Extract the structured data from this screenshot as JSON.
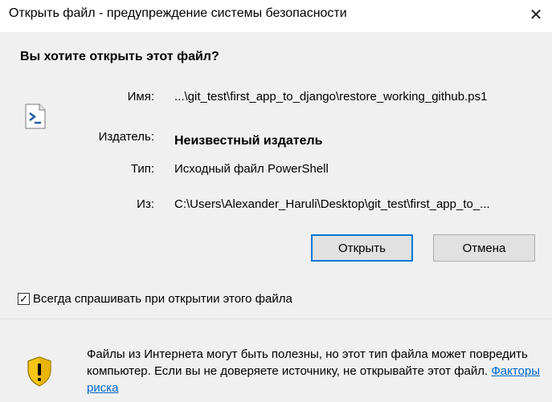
{
  "window": {
    "title": "Открыть файл - предупреждение системы безопасности",
    "close_glyph": "✕"
  },
  "question": "Вы хотите открыть этот файл?",
  "file_icon": "powershell-script-icon",
  "fields": {
    "name_label": "Имя:",
    "name_value": "...\\git_test\\first_app_to_django\\restore_working_github.ps1",
    "publisher_label": "Издатель:",
    "publisher_value": "Неизвестный издатель",
    "type_label": "Тип:",
    "type_value": "Исходный файл PowerShell",
    "from_label": "Из:",
    "from_value": "C:\\Users\\Alexander_Haruli\\Desktop\\git_test\\first_app_to_..."
  },
  "buttons": {
    "open_label": "Открыть",
    "cancel_label": "Отмена"
  },
  "checkbox": {
    "label": "Всегда спрашивать при открытии этого файла",
    "checked": true,
    "check_glyph": "✓"
  },
  "footer": {
    "icon": "security-shield-warning-icon",
    "warning_text": "Файлы из Интернета могут быть полезны, но этот тип файла может повредить компьютер. Если вы не доверяете источнику, не открывайте этот файл.",
    "risk_link": "Факторы риска"
  },
  "colors": {
    "body_background": "#f0f0f0",
    "accent_border": "#0078d7",
    "link": "#0066cc",
    "shield_yellow": "#f5c518"
  }
}
